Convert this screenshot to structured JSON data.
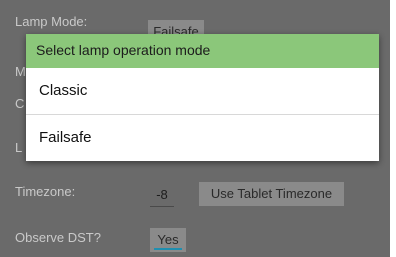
{
  "settings": {
    "lamp_mode_label": "Lamp Mode:",
    "lamp_mode_value": "Failsafe",
    "hidden_row_initials": [
      "M",
      "C",
      "L"
    ],
    "timezone_label": "Timezone:",
    "timezone_value": "-8",
    "use_tablet_timezone_button": "Use Tablet Timezone",
    "observe_dst_label": "Observe DST?",
    "observe_dst_value": "Yes"
  },
  "dialog": {
    "title": "Select lamp operation mode",
    "options": [
      {
        "label": "Classic"
      },
      {
        "label": "Failsafe"
      }
    ]
  },
  "colors": {
    "dialog_header": "#8bc77a",
    "accent_underline": "#1f8fb0",
    "dim_background": "#6a6a6a"
  }
}
